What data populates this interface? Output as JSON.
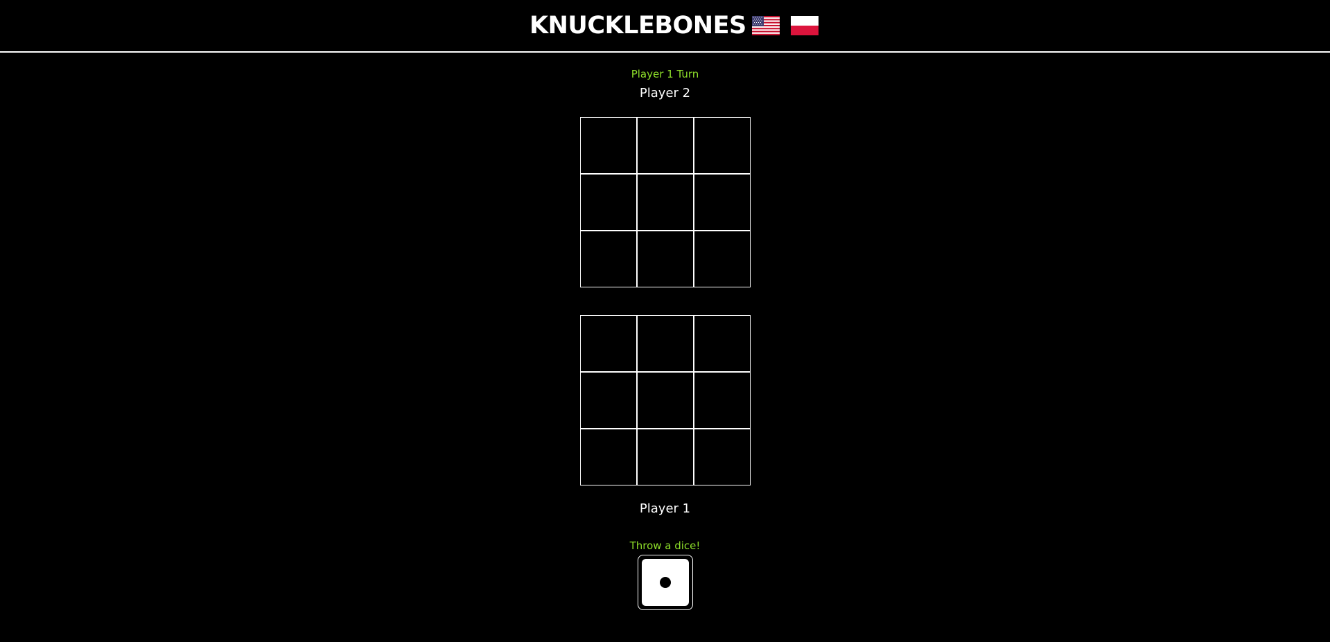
{
  "header": {
    "title": "KNUCKLEBONES",
    "languages": [
      {
        "name": "us-flag-icon",
        "code": "en"
      },
      {
        "name": "poland-flag-icon",
        "code": "pl"
      }
    ]
  },
  "game": {
    "turn_text": "Player 1 Turn",
    "player2_label": "Player 2",
    "player1_label": "Player 1",
    "throw_prompt": "Throw a dice!",
    "dice_value": 1,
    "player2_board": [
      [
        "",
        "",
        ""
      ],
      [
        "",
        "",
        ""
      ],
      [
        "",
        "",
        ""
      ]
    ],
    "player1_board": [
      [
        "",
        "",
        ""
      ],
      [
        "",
        "",
        ""
      ],
      [
        "",
        "",
        ""
      ]
    ]
  },
  "colors": {
    "background": "#000000",
    "foreground": "#ffffff",
    "accent": "#8fe12a"
  }
}
